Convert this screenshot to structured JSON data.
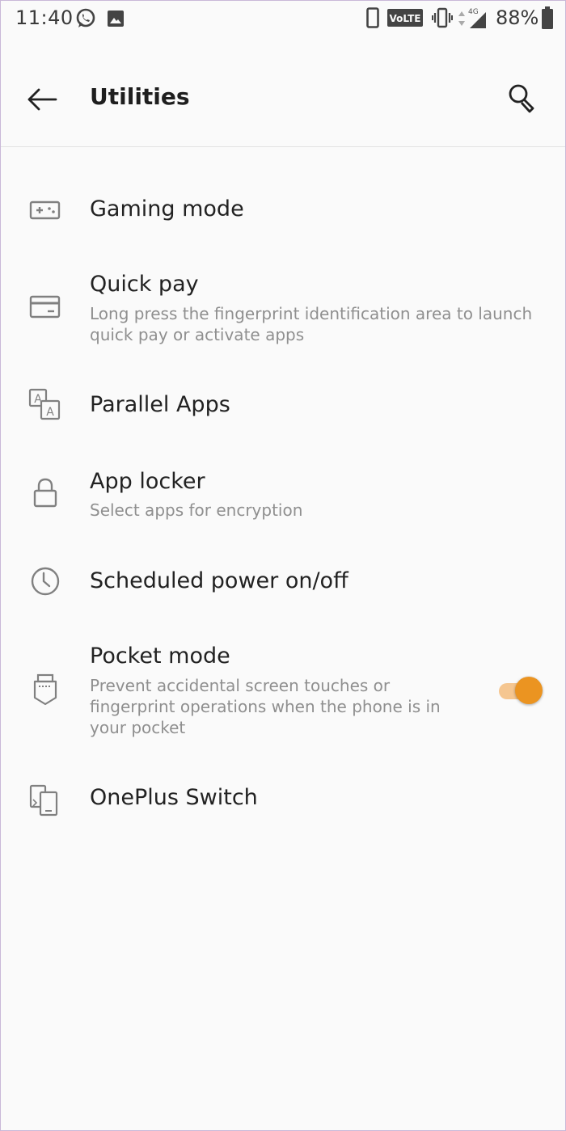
{
  "status_bar": {
    "time": "11:40",
    "battery": "88%",
    "network_label": "VoLTE",
    "signal_label": "4G"
  },
  "toolbar": {
    "title": "Utilities"
  },
  "items": [
    {
      "title": "Gaming mode",
      "subtitle": "",
      "icon": "gamepad-icon"
    },
    {
      "title": "Quick pay",
      "subtitle": "Long press the fingerprint identification area to launch quick pay or activate apps",
      "icon": "card-icon"
    },
    {
      "title": "Parallel Apps",
      "subtitle": "",
      "icon": "parallel-apps-icon"
    },
    {
      "title": "App locker",
      "subtitle": "Select apps for encryption",
      "icon": "lock-icon"
    },
    {
      "title": "Scheduled power on/off",
      "subtitle": "",
      "icon": "clock-icon"
    },
    {
      "title": "Pocket mode",
      "subtitle": "Prevent accidental screen touches or fingerprint operations when the phone is in your pocket",
      "icon": "pocket-icon",
      "toggle_on": true
    },
    {
      "title": "OnePlus Switch",
      "subtitle": "",
      "icon": "phone-switch-icon"
    }
  ],
  "colors": {
    "accent": "#eb9421",
    "background": "#fafafa"
  }
}
